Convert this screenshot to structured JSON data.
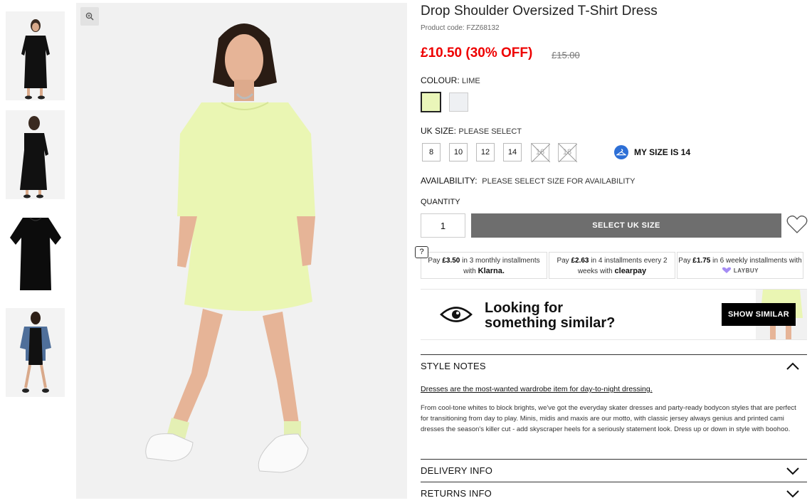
{
  "product": {
    "title": "Drop Shoulder Oversized T-Shirt Dress",
    "product_code": "Product code: FZZ68132",
    "price_now": "£10.50 (30% OFF)",
    "price_was": "£15.00"
  },
  "colour": {
    "label": "COLOUR:",
    "value": "LIME",
    "swatches": [
      {
        "name": "lime",
        "color": "#eaf6b9",
        "selected": true
      },
      {
        "name": "grey",
        "color": "#eef0f3",
        "selected": false
      }
    ]
  },
  "size": {
    "label": "UK SIZE:",
    "value": "PLEASE SELECT",
    "options": [
      "8",
      "10",
      "12",
      "14",
      "16",
      "18"
    ],
    "out_of_stock": [
      "16",
      "18"
    ],
    "my_size": "MY SIZE IS 14"
  },
  "availability": {
    "label": "AVAILABILITY:",
    "value": "PLEASE SELECT SIZE FOR AVAILABILITY"
  },
  "quantity": {
    "label": "QUANTITY",
    "value": "1"
  },
  "add_button": "SELECT UK SIZE",
  "help_icon_text": "?",
  "payments": {
    "klarna": {
      "pre": "Pay ",
      "amount": "£3.50",
      "mid": " in 3 monthly installments with ",
      "brand": "Klarna."
    },
    "clearpay": {
      "pre": "Pay ",
      "amount": "£2.63",
      "mid": " in 4 installments every 2 weeks with ",
      "brand": "clearpay"
    },
    "laybuy": {
      "pre": "Pay ",
      "amount": "£1.75",
      "mid": " in 6 weekly installments with ",
      "brand": "LAYBUY"
    }
  },
  "similar": {
    "line1": "Looking for",
    "line2": "something similar?",
    "button": "SHOW SIMILAR"
  },
  "style_notes": {
    "heading": "STYLE NOTES",
    "link": "Dresses are the most-wanted wardrobe item for day-to-night dressing.",
    "body": "From cool-tone whites to block brights, we've got the everyday skater dresses and party-ready bodycon styles that are perfect for transitioning from day to play. Minis, midis and maxis are our motto, with classic jersey always genius and printed cami dresses the season's killer cut - add skyscraper heels for a seriously statement look. Dress up or down in style with boohoo."
  },
  "delivery_heading": "DELIVERY INFO",
  "returns_heading": "RETURNS INFO",
  "colors": {
    "sale_red": "#ee0000",
    "button_grey": "#6e6e6e",
    "mysize_blue": "#2d6fd6",
    "dress_lime": "#eaf6b9"
  }
}
